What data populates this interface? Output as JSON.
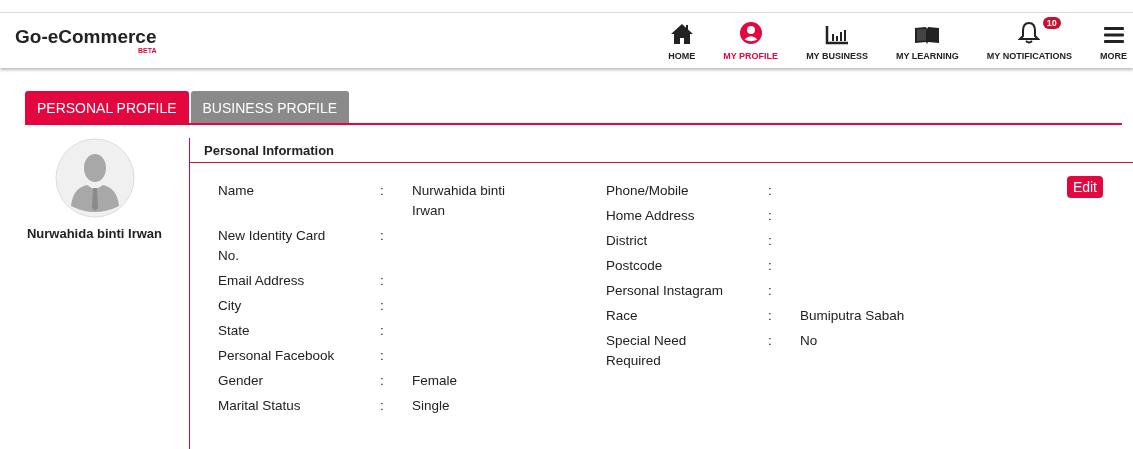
{
  "header": {
    "logo": "Go-eCommerce",
    "badge": "BETA"
  },
  "nav": [
    {
      "label": "HOME",
      "kind": "home",
      "selected": false
    },
    {
      "label": "MY PROFILE",
      "kind": "profile",
      "selected": true
    },
    {
      "label": "MY BUSINESS",
      "kind": "chart",
      "selected": false
    },
    {
      "label": "MY LEARNING",
      "kind": "book",
      "selected": false
    },
    {
      "label": "MY NOTIFICATIONS",
      "kind": "bell",
      "selected": false,
      "count": "10"
    },
    {
      "label": "MORE",
      "kind": "menu",
      "selected": false
    }
  ],
  "tabs": [
    {
      "label": "PERSONAL PROFILE",
      "selected": true
    },
    {
      "label": "BUSINESS PROFILE",
      "selected": false
    }
  ],
  "profile": {
    "name": "Nurwahida binti Irwan"
  },
  "section_title": "Personal Information",
  "edit_button": "Edit",
  "left_fields": [
    {
      "label": "Name",
      "value": "Nurwahida binti Irwan"
    },
    {
      "label": "New Identity Card No."
    },
    {
      "label": "Email Address"
    },
    {
      "label": "City"
    },
    {
      "label": "State"
    },
    {
      "label": "Personal Facebook"
    },
    {
      "label": "Gender",
      "value": "Female"
    },
    {
      "label": "Marital Status",
      "value": "Single"
    }
  ],
  "right_fields": [
    {
      "label": "Phone/Mobile"
    },
    {
      "label": "Home Address"
    },
    {
      "label": "District"
    },
    {
      "label": "Postcode"
    },
    {
      "label": "Personal Instagram"
    },
    {
      "label": "Race",
      "value": "Bumiputra Sabah"
    },
    {
      "label": "Special Need Required",
      "value": "No"
    }
  ],
  "colon": ":"
}
